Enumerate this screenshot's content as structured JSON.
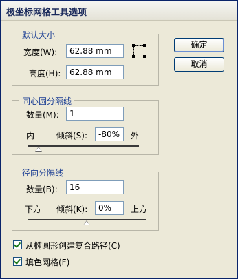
{
  "dialog": {
    "title": "极坐标网格工具选项"
  },
  "buttons": {
    "ok": "确定",
    "cancel": "取消"
  },
  "default_size": {
    "title": "默认大小",
    "width_label": "宽度(W):",
    "width_value": "62.88 mm",
    "height_label": "高度(H):",
    "height_value": "62.88 mm",
    "anchor_icon": "anchor-point-icon"
  },
  "concentric": {
    "title": "同心圆分隔线",
    "count_label": "数量(M):",
    "count_value": "1",
    "left_label": "内",
    "skew_label": "倾斜(S):",
    "skew_value": "-80%",
    "right_label": "外",
    "slider_value_percent": -80
  },
  "radial": {
    "title": "径向分隔线",
    "count_label": "数量(B):",
    "count_value": "16",
    "left_label": "下方",
    "skew_label": "倾斜(K):",
    "skew_value": "0%",
    "right_label": "上方",
    "slider_value_percent": 0
  },
  "options": {
    "compound_path_label": "从椭圆形创建复合路径(C)",
    "compound_path_checked": true,
    "fill_grid_label": "填色网格(F)",
    "fill_grid_checked": true
  },
  "colors": {
    "group_title": "#1c3f94",
    "dialog_bg": "#ece9d8"
  }
}
